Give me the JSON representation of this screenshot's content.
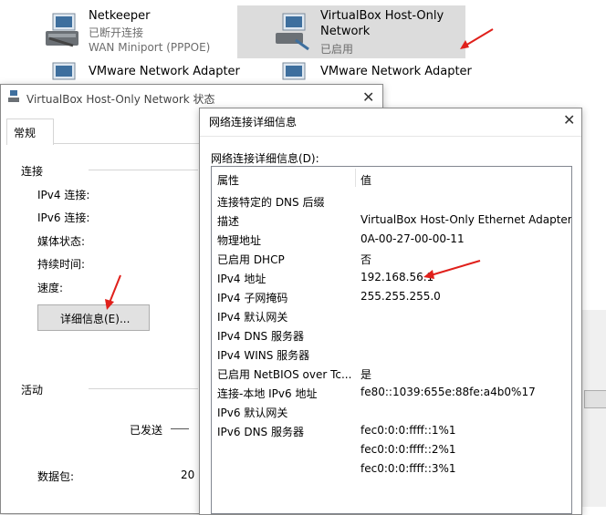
{
  "adapters": [
    {
      "name": "Netkeeper",
      "status": "已断开连接",
      "device": "WAN Miniport (PPPOE)"
    },
    {
      "name": "VirtualBox Host-Only",
      "name_line2": "Network",
      "status": "已启用",
      "device": ""
    },
    {
      "name": "VMware Network Adapter",
      "status": "",
      "device": ""
    },
    {
      "name": "VMware Network Adapter",
      "status": "",
      "device": ""
    }
  ],
  "status_window": {
    "title": "VirtualBox Host-Only Network 状态",
    "tab": "常规",
    "connection_header": "连接",
    "fields": [
      "IPv4 连接:",
      "IPv6 连接:",
      "媒体状态:",
      "持续时间:",
      "速度:"
    ],
    "details_button": "详细信息(E)...",
    "activity_header": "活动",
    "sent_label": "已发送",
    "packets_label": "数据包:",
    "packets_sent": "20"
  },
  "details_window": {
    "title": "网络连接详细信息",
    "caption": "网络连接详细信息(D):",
    "columns": [
      "属性",
      "值"
    ],
    "rows": [
      {
        "prop": "连接特定的 DNS 后缀",
        "val": ""
      },
      {
        "prop": "描述",
        "val": "VirtualBox Host-Only Ethernet Adapter"
      },
      {
        "prop": "物理地址",
        "val": "0A-00-27-00-00-11"
      },
      {
        "prop": "已启用 DHCP",
        "val": "否"
      },
      {
        "prop": "IPv4 地址",
        "val": "192.168.56.1"
      },
      {
        "prop": "IPv4 子网掩码",
        "val": "255.255.255.0"
      },
      {
        "prop": "IPv4 默认网关",
        "val": ""
      },
      {
        "prop": "IPv4 DNS 服务器",
        "val": ""
      },
      {
        "prop": "IPv4 WINS 服务器",
        "val": ""
      },
      {
        "prop": "已启用 NetBIOS over Tc...",
        "val": "是"
      },
      {
        "prop": "连接-本地 IPv6 地址",
        "val": "fe80::1039:655e:88fe:a4b0%17"
      },
      {
        "prop": "IPv6 默认网关",
        "val": ""
      },
      {
        "prop": "IPv6 DNS 服务器",
        "val": "fec0:0:0:ffff::1%1"
      },
      {
        "prop": "",
        "val": "fec0:0:0:ffff::2%1"
      },
      {
        "prop": "",
        "val": "fec0:0:0:ffff::3%1"
      }
    ]
  },
  "colors": {
    "annotation_red": "#e0201b",
    "selection": "#dcdcdc"
  }
}
